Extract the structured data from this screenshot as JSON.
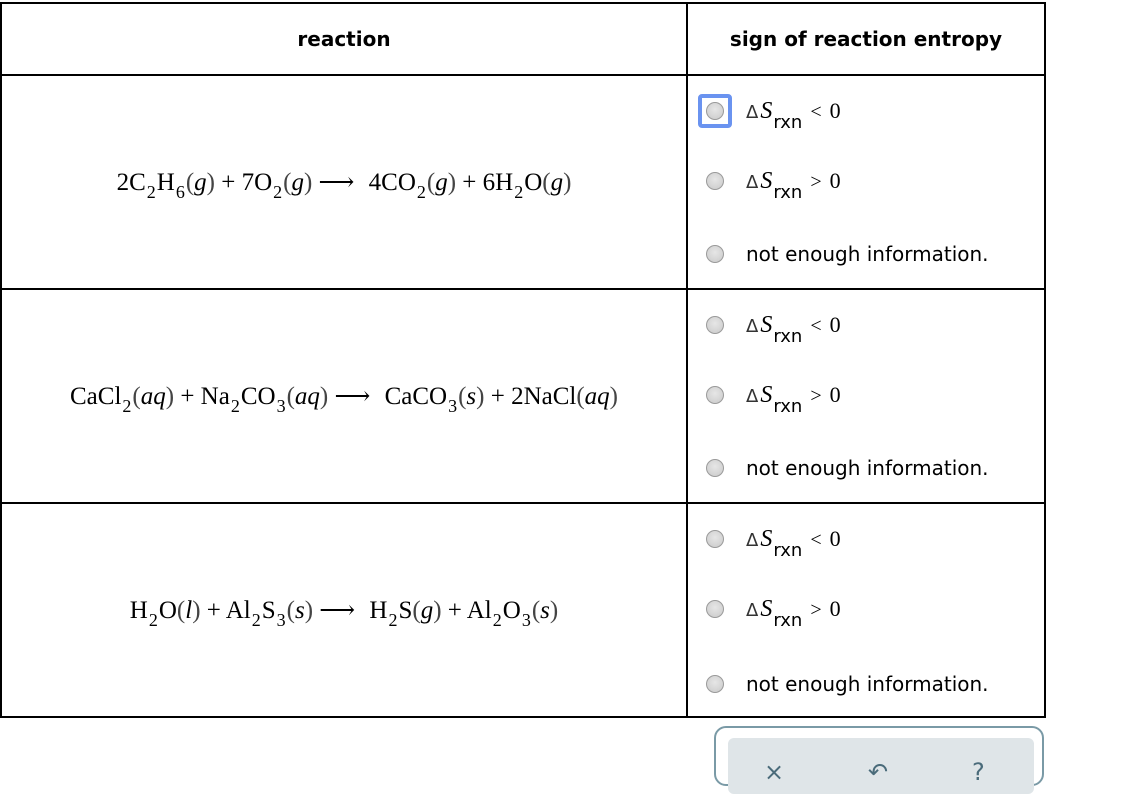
{
  "table": {
    "headers": {
      "reaction": "reaction",
      "sign": "sign of reaction entropy"
    },
    "rows": [
      {
        "equation": "2C2H6(g) + 7O2(g) → 4CO2(g) + 6H2O(g)",
        "options": [
          {
            "label": "ΔS_rxn < 0",
            "relation": "<",
            "value": "0",
            "selected": false,
            "focused": true
          },
          {
            "label": "ΔS_rxn > 0",
            "relation": ">",
            "value": "0",
            "selected": false,
            "focused": false
          },
          {
            "label": "not enough information.",
            "selected": false
          }
        ]
      },
      {
        "equation": "CaCl2(aq) + Na2CO3(aq) → CaCO3(s) + 2NaCl(aq)",
        "options": [
          {
            "label": "ΔS_rxn < 0",
            "relation": "<",
            "value": "0",
            "selected": false
          },
          {
            "label": "ΔS_rxn > 0",
            "relation": ">",
            "value": "0",
            "selected": false
          },
          {
            "label": "not enough information.",
            "selected": false
          }
        ]
      },
      {
        "equation": "H2O(l) + Al2S3(s) → H2S(g) + Al2O3(s)",
        "options": [
          {
            "label": "ΔS_rxn < 0",
            "relation": "<",
            "value": "0",
            "selected": false
          },
          {
            "label": "ΔS_rxn > 0",
            "relation": ">",
            "value": "0",
            "selected": false
          },
          {
            "label": "not enough information.",
            "selected": false
          }
        ]
      }
    ]
  },
  "symbols": {
    "delta": "Δ",
    "S": "S",
    "rxn": "rxn",
    "lt": "<",
    "gt": ">",
    "zero": "0",
    "arrow": "⟶",
    "plus": "+"
  },
  "option_text": {
    "not_enough": "not enough information."
  },
  "toolbar": {
    "icons": [
      "close-icon",
      "undo-icon",
      "help-icon"
    ],
    "glyphs": {
      "close": "×",
      "undo": "↶",
      "help": "?"
    }
  }
}
